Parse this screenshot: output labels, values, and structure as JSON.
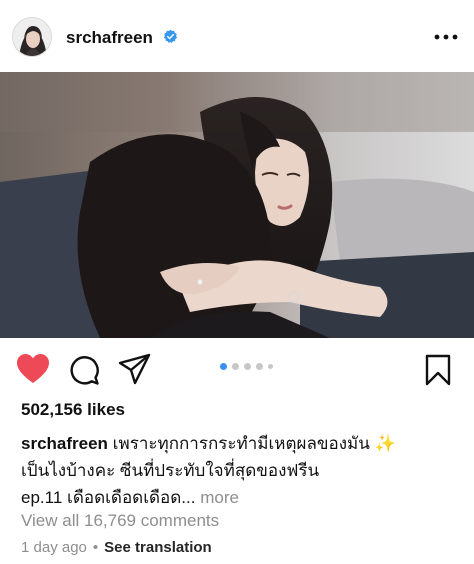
{
  "post": {
    "username": "srchafreen",
    "verified_icon": "verified-badge-icon",
    "more_icon": "more-options-icon",
    "accent_color": "#3897f0",
    "like_color": "#ed4956"
  },
  "actions": {
    "like_icon": "heart-icon",
    "comment_icon": "comment-icon",
    "share_icon": "share-icon",
    "save_icon": "bookmark-icon",
    "carousel_total": 5,
    "carousel_active": 1
  },
  "likes": "502,156 likes",
  "caption": {
    "username": "srchafreen",
    "line1": "เพราะทุกการกระทำมีเหตุผลของมัน ✨",
    "line2": "เป็นไงบ้างคะ ซีนที่ประทับใจที่สุดของฟรีน",
    "line3": "ep.11 เดือดเดือดเดือด...",
    "more": "more"
  },
  "comments": {
    "view_all": "View all 16,769 comments"
  },
  "meta": {
    "time": "1 day ago",
    "separator": "•",
    "translate": "See translation"
  }
}
